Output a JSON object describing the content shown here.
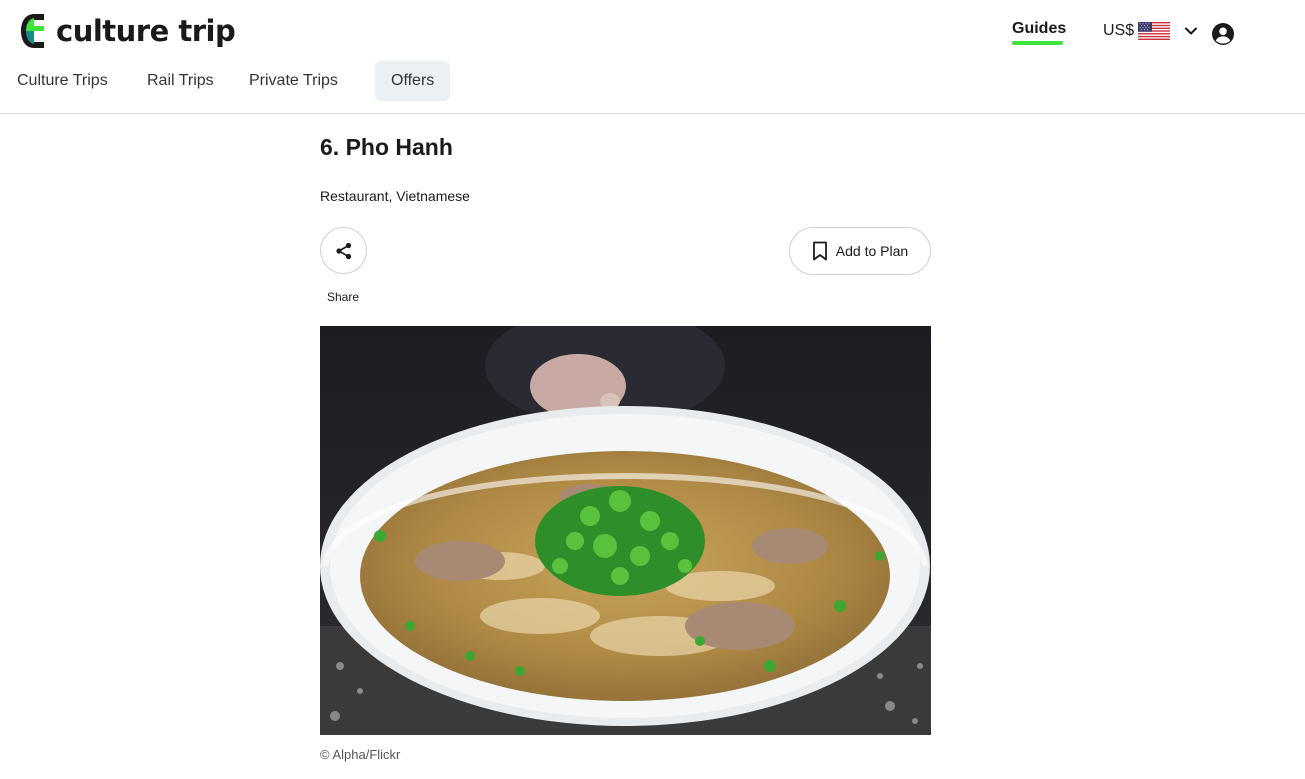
{
  "brand": {
    "name": "culture trip",
    "colors": {
      "green": "#3fe33a",
      "teal": "#1a8a8a",
      "dark": "#1a1a1a"
    }
  },
  "header": {
    "guides_label": "Guides",
    "currency_label": "US$",
    "flag_icon": "us-flag-icon",
    "dropdown_icon": "chevron-down-icon",
    "account_icon": "account-circle-icon"
  },
  "subnav": {
    "items": [
      {
        "label": "Culture Trips"
      },
      {
        "label": "Rail Trips"
      },
      {
        "label": "Private Trips"
      },
      {
        "label": "Offers"
      }
    ]
  },
  "article": {
    "title": "6. Pho Hanh",
    "category": "Restaurant, Vietnamese",
    "share_label": "Share",
    "add_to_plan_label": "Add to Plan",
    "image_credit": "© Alpha/Flickr"
  }
}
